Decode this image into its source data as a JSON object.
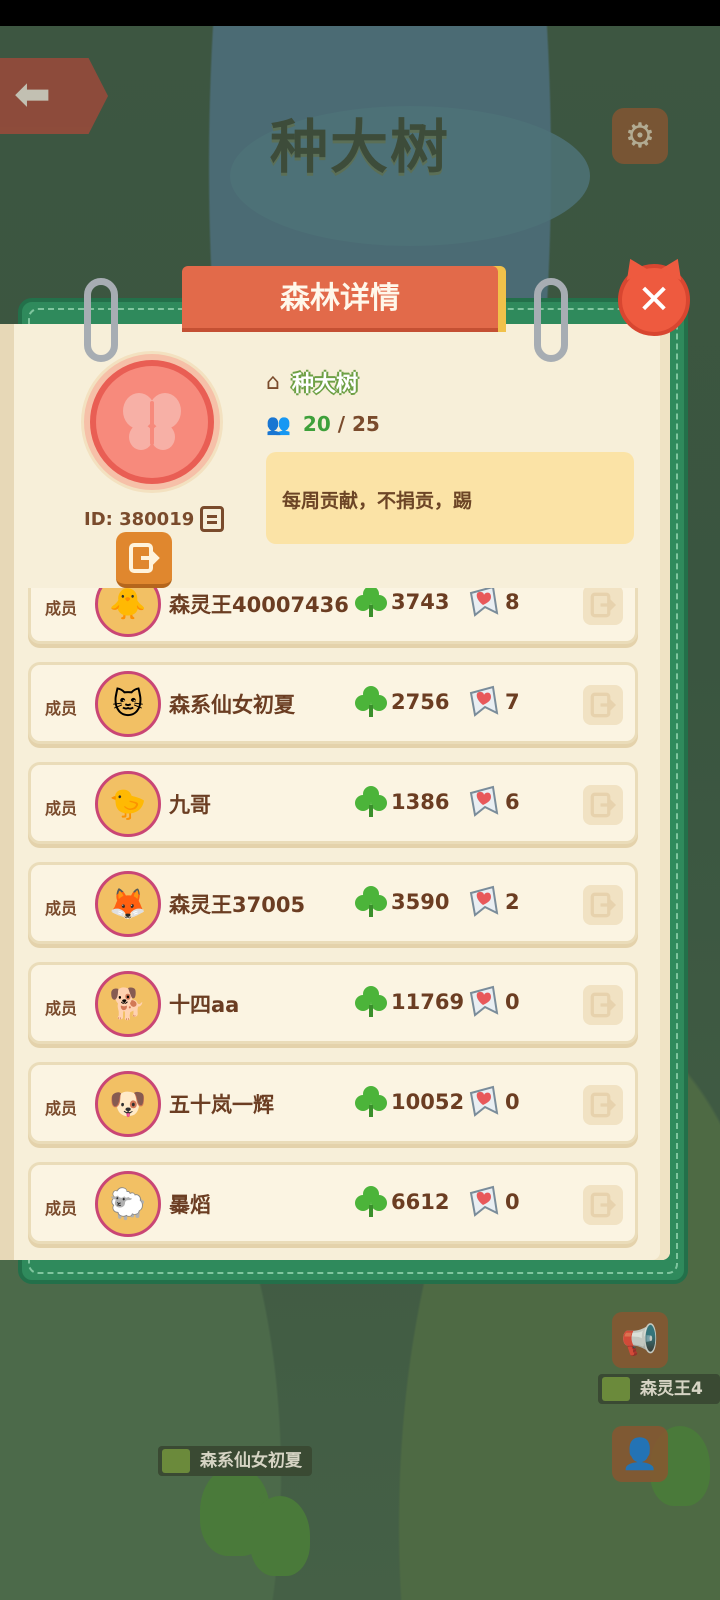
{
  "header": {
    "game_title": "种大树"
  },
  "panel": {
    "title": "森林详情"
  },
  "forest": {
    "name": "种大树",
    "id_text": "ID: 380019",
    "member_count_current": "20",
    "member_count_sep": "/",
    "member_count_max": "25",
    "notice": "每周贡献，不捐贡，踢",
    "accent_color": "#e95e54"
  },
  "members": [
    {
      "rank": "成员",
      "name": "森灵王40007436",
      "contribution": "3743",
      "likes": "8",
      "avatar": "🐥"
    },
    {
      "rank": "成员",
      "name": "森系仙女初夏",
      "contribution": "2756",
      "likes": "7",
      "avatar": "🐱"
    },
    {
      "rank": "成员",
      "name": "九哥",
      "contribution": "1386",
      "likes": "6",
      "avatar": "🐤"
    },
    {
      "rank": "成员",
      "name": "森灵王37005",
      "contribution": "3590",
      "likes": "2",
      "avatar": "🦊"
    },
    {
      "rank": "成员",
      "name": "十四aa",
      "contribution": "11769",
      "likes": "0",
      "avatar": "🐕"
    },
    {
      "rank": "成员",
      "name": "五十岚一辉",
      "contribution": "10052",
      "likes": "0",
      "avatar": "🐶"
    },
    {
      "rank": "成员",
      "name": "㬥熖",
      "contribution": "6612",
      "likes": "0",
      "avatar": "🐑"
    }
  ],
  "map_tags": {
    "left": "森系仙女初夏",
    "right": "森灵王4"
  },
  "colors": {
    "panel_green": "#2f8a5c",
    "tab_red": "#e26a4a",
    "paper": "#f7efd9",
    "clover_green": "#4cb43a",
    "heart_red": "#e8585a"
  }
}
